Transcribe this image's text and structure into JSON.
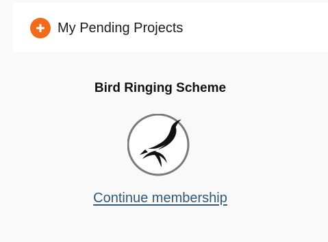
{
  "header": {
    "title": "My Pending Projects",
    "icon": "plus-circle-icon",
    "accent_color": "#f26a1b"
  },
  "project": {
    "name": "Bird Ringing Scheme",
    "logo_icon": "bird-logo-icon",
    "action_label": "Continue membership",
    "link_color": "#2f5877"
  }
}
